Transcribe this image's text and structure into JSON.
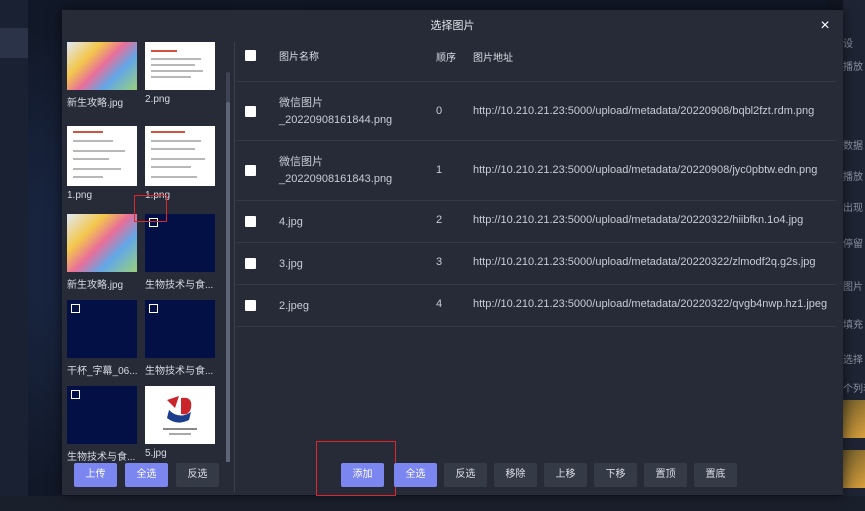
{
  "dialog": {
    "title": "选择图片",
    "close": "×"
  },
  "gallery": {
    "items": [
      {
        "caption": "新生攻略.jpg",
        "thumb": "map",
        "checkbox": false
      },
      {
        "caption": "2.png",
        "thumb": "doc",
        "checkbox": false
      },
      {
        "caption": "1.png",
        "thumb": "doc",
        "checkbox": false
      },
      {
        "caption": "1.png",
        "thumb": "doc",
        "checkbox": false
      },
      {
        "caption": "新生攻略.jpg",
        "thumb": "map",
        "checkbox": false
      },
      {
        "caption": "生物技术与食...",
        "thumb": "dark",
        "checkbox": true
      },
      {
        "caption": "干杯_字幕_06...",
        "thumb": "dark",
        "checkbox": true
      },
      {
        "caption": "生物技术与食...",
        "thumb": "dark",
        "checkbox": true
      },
      {
        "caption": "生物技术与食...",
        "thumb": "dark",
        "checkbox": true
      },
      {
        "caption": "5.jpg",
        "thumb": "logo",
        "checkbox": false
      }
    ],
    "buttons": {
      "upload": "上传",
      "select_all": "全选",
      "invert": "反选"
    }
  },
  "table": {
    "headers": {
      "name": "图片名称",
      "order": "顺序",
      "url": "图片地址"
    },
    "rows": [
      {
        "name": "微信图片_20220908161844.png",
        "order": "0",
        "url": "http://10.210.21.23:5000/upload/metadata/20220908/bqbl2fzt.rdm.png"
      },
      {
        "name": "微信图片_20220908161843.png",
        "order": "1",
        "url": "http://10.210.21.23:5000/upload/metadata/20220908/jyc0pbtw.edn.png"
      },
      {
        "name": "4.jpg",
        "order": "2",
        "url": "http://10.210.21.23:5000/upload/metadata/20220322/hiibfkn.1o4.jpg"
      },
      {
        "name": "3.jpg",
        "order": "3",
        "url": "http://10.210.21.23:5000/upload/metadata/20220322/zlmodf2q.g2s.jpg"
      },
      {
        "name": "2.jpeg",
        "order": "4",
        "url": "http://10.210.21.23:5000/upload/metadata/20220322/qvgb4nwp.hz1.jpeg"
      }
    ]
  },
  "toolbar": {
    "add": "添加",
    "select_all": "全选",
    "invert": "反选",
    "remove": "移除",
    "move_up": "上移",
    "move_down": "下移",
    "to_top": "置顶",
    "to_bottom": "置底"
  },
  "background": {
    "right_labels": [
      "设",
      "播放",
      "数据",
      "播放",
      "出现",
      "停留",
      "图片",
      "填充",
      "选择",
      "个列表"
    ]
  },
  "colors": {
    "primary_button": "#7c86f0",
    "modal_bg": "#272b37",
    "highlight_box": "#e0262a"
  }
}
